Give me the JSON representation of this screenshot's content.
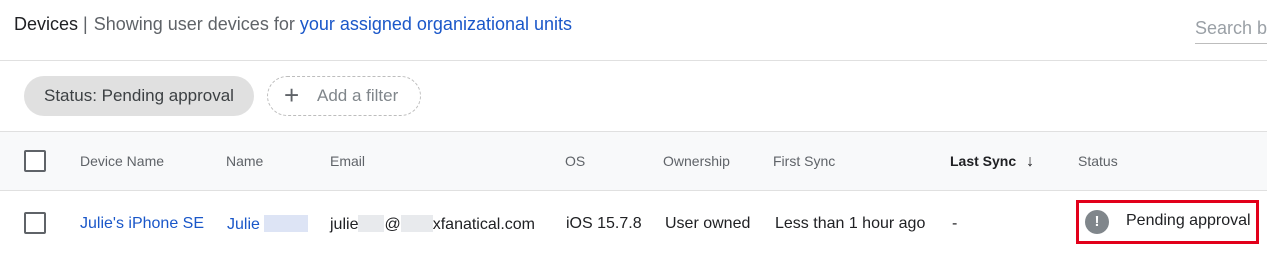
{
  "header": {
    "title": "Devices",
    "separator": "|",
    "description": "Showing user devices for",
    "scope_link": "your assigned organizational units",
    "search_placeholder": "Search b"
  },
  "filters": {
    "active_chip": "Status: Pending approval",
    "add_filter_label": "Add a filter"
  },
  "table": {
    "columns": {
      "device_name": "Device Name",
      "name": "Name",
      "email": "Email",
      "os": "OS",
      "ownership": "Ownership",
      "first_sync": "First Sync",
      "last_sync": "Last Sync",
      "status": "Status"
    },
    "sorted_by": "last_sync",
    "sort_direction": "descending",
    "rows": [
      {
        "device_name": "Julie's iPhone SE",
        "name": "Julie",
        "email_part1": "julie",
        "email_part2": "@",
        "email_part3": "xfanatical.com",
        "os": "iOS 15.7.8",
        "ownership": "User owned",
        "first_sync": "Less than 1 hour ago",
        "last_sync": "-",
        "status": "Pending approval",
        "status_icon": "!"
      }
    ]
  },
  "colors": {
    "link": "#1a57c9",
    "highlight": "#e2001a",
    "status_icon": "#80868b"
  }
}
